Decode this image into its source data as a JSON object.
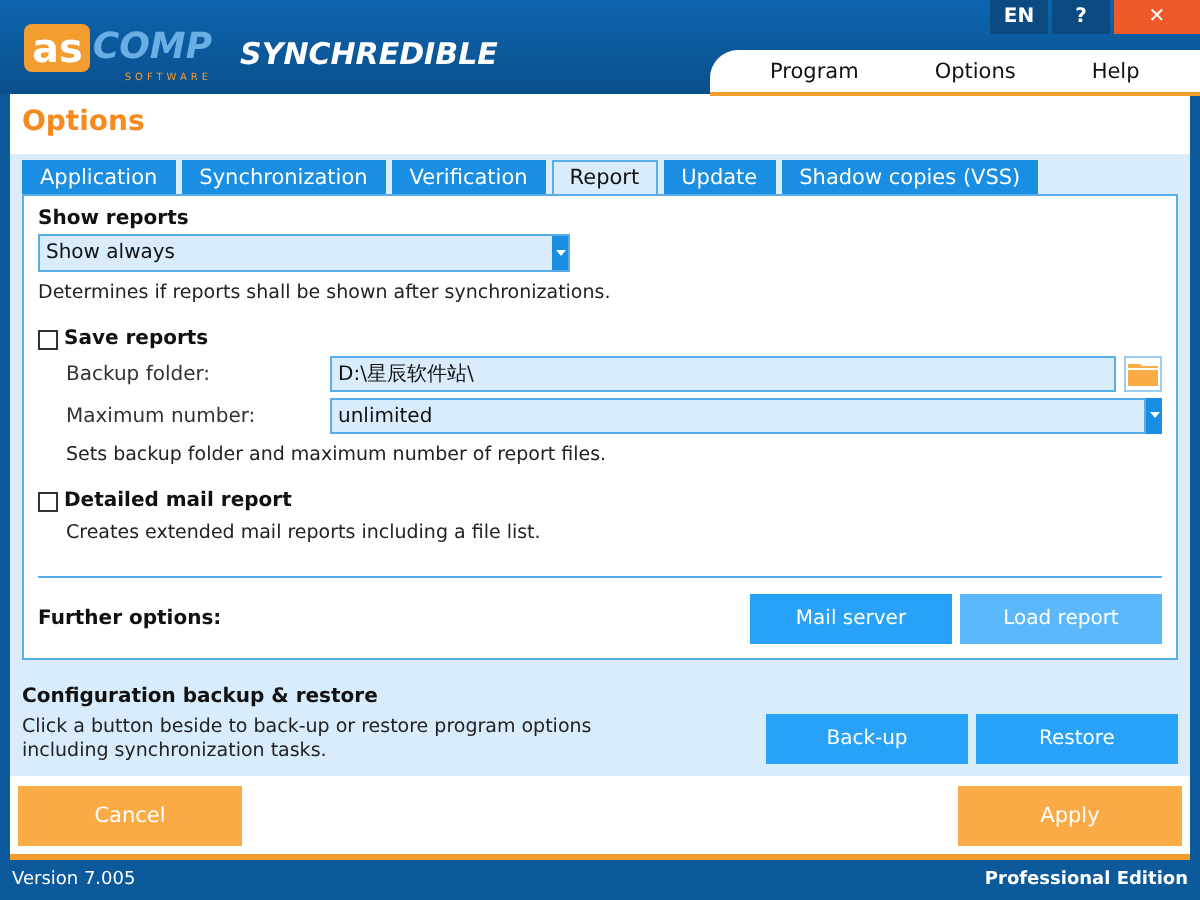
{
  "logo": {
    "mark": "as",
    "word": "COMP",
    "sub": "SOFTWARE",
    "product": "SYNCHREDIBLE"
  },
  "title_buttons": [
    {
      "kind": "lang",
      "label": "EN"
    },
    {
      "kind": "help",
      "label": "?"
    },
    {
      "kind": "close",
      "label": "✕"
    }
  ],
  "menu": [
    "Program",
    "Options",
    "Help"
  ],
  "page_title": "Options",
  "tabs": [
    {
      "label": "Application",
      "selected": false
    },
    {
      "label": "Synchronization",
      "selected": false
    },
    {
      "label": "Verification",
      "selected": false
    },
    {
      "label": "Report",
      "selected": true
    },
    {
      "label": "Update",
      "selected": false
    },
    {
      "label": "Shadow copies (VSS)",
      "selected": false
    }
  ],
  "show_reports": {
    "heading": "Show reports",
    "value": "Show always",
    "hint": "Determines if reports shall be shown after synchronizations."
  },
  "save_reports": {
    "label": "Save reports",
    "checked": false,
    "backup_label": "Backup folder:",
    "backup_value": "D:\\星辰软件站\\",
    "max_label": "Maximum number:",
    "max_value": "unlimited",
    "hint": "Sets backup folder and maximum number of report files."
  },
  "mail_report": {
    "label": "Detailed mail report",
    "checked": false,
    "hint": "Creates extended mail reports including a file list."
  },
  "further": {
    "label": "Further options:",
    "buttons": [
      {
        "label": "Mail server",
        "disabled": false
      },
      {
        "label": "Load report",
        "disabled": true
      }
    ]
  },
  "config": {
    "heading": "Configuration backup & restore",
    "text": "Click a button beside to back-up or restore program options including synchronization tasks.",
    "buttons": [
      {
        "label": "Back-up",
        "disabled": false
      },
      {
        "label": "Restore",
        "disabled": false
      }
    ]
  },
  "footer_buttons": [
    {
      "label": "Cancel"
    },
    {
      "label": "Apply"
    }
  ],
  "status": {
    "version": "Version 7.005",
    "edition": "Professional Edition"
  }
}
